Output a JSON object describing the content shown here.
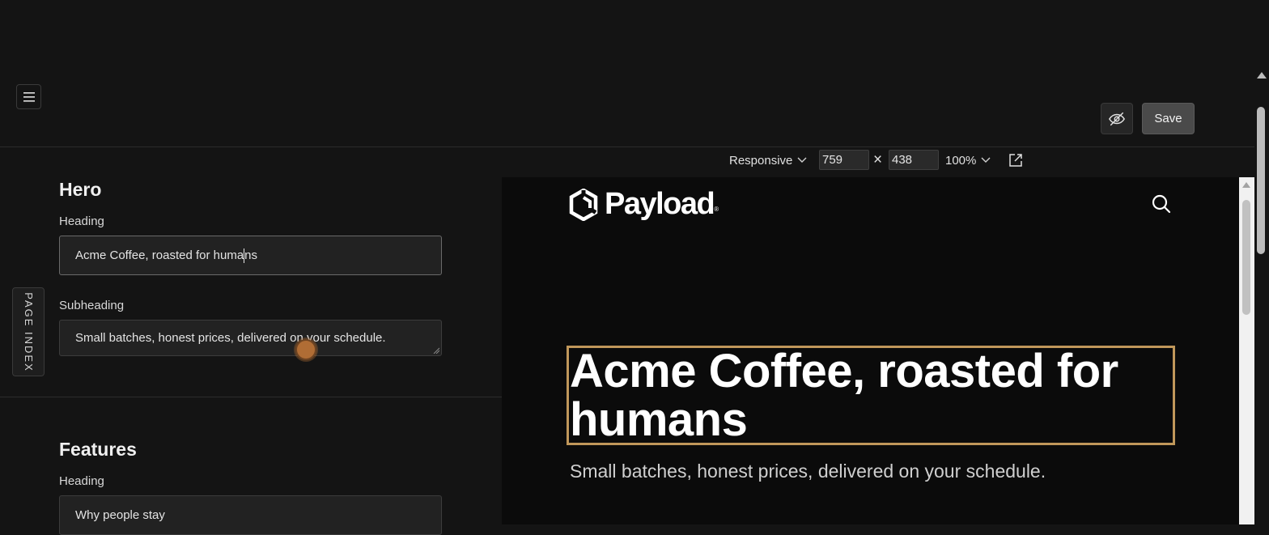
{
  "header": {
    "save_label": "Save"
  },
  "page_index": {
    "label": "PAGE INDEX"
  },
  "editor": {
    "hero": {
      "title": "Hero",
      "heading_label": "Heading",
      "heading_value_before_caret": "Acme Coffee, roasted for huma",
      "heading_value_after_caret": "ns",
      "subheading_label": "Subheading",
      "subheading_value": "Small batches, honest prices, delivered on your schedule."
    },
    "features": {
      "title": "Features",
      "heading_label": "Heading",
      "heading_value": "Why people stay"
    }
  },
  "preview_toolbar": {
    "device": "Responsive",
    "width": "759",
    "height": "438",
    "times": "×",
    "zoom": "100%"
  },
  "preview": {
    "brand": "Payload",
    "reg_mark": "®",
    "hero_title": "Acme Coffee, roasted for humans",
    "hero_subtitle": "Small batches, honest prices, delivered on your schedule."
  },
  "colors": {
    "background": "#141414",
    "preview_background": "#0b0b0b",
    "highlight_border": "#c0975a",
    "cursor": "#b06d35"
  }
}
